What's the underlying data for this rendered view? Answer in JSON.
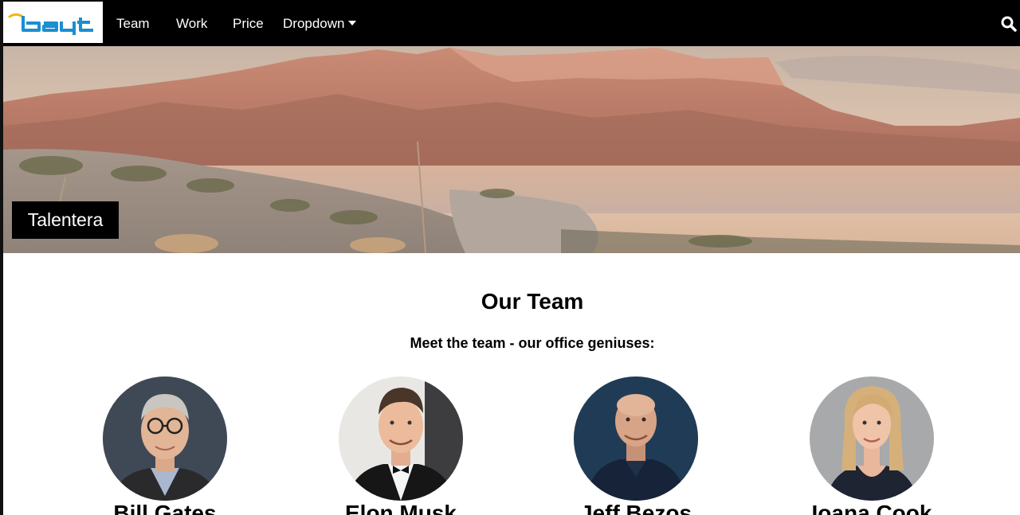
{
  "navbar": {
    "logo_text": "bayt",
    "items": [
      {
        "label": "Team"
      },
      {
        "label": "Work"
      },
      {
        "label": "Price"
      },
      {
        "label": "Dropdown"
      }
    ],
    "search_icon": "search-icon",
    "dropdown_icon": "caret-down-icon"
  },
  "hero": {
    "caption": "Talentera"
  },
  "team": {
    "heading": "Our Team",
    "subheading": "Meet the team - our office geniuses:",
    "members": [
      {
        "name": "Bill Gates"
      },
      {
        "name": "Elon Musk"
      },
      {
        "name": "Jeff Bezos"
      },
      {
        "name": "Ioana Cook"
      }
    ]
  },
  "colors": {
    "navbar_bg": "#000000",
    "logo_blue": "#1a8fd1",
    "logo_gold": "#f2b705",
    "text": "#000000"
  }
}
